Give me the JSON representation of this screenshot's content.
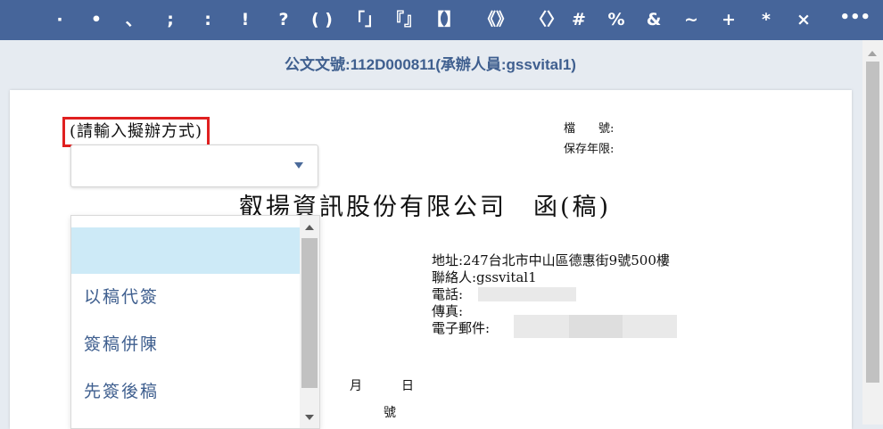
{
  "toolbar": {
    "symbols": [
      "·",
      "•",
      "、",
      ";",
      ":",
      "!",
      "?",
      "( )",
      "「」",
      "『』",
      "【】",
      "《》",
      "〈〉",
      "#",
      "%",
      "&",
      "~",
      "+",
      "*",
      "×"
    ],
    "more": "•••"
  },
  "header": {
    "doc_number": "公文文號:112D000811(承辦人員:gssvital1)"
  },
  "form": {
    "method_label": "(請輸入擬辦方式)",
    "select_value": ""
  },
  "meta": {
    "file_no_label": "檔　　號:",
    "retention_label": "保存年限:"
  },
  "document": {
    "org_title": "叡揚資訊股份有限公司　函(稿)",
    "address": "地址:247台北市中山區德惠街9號500樓",
    "contact": "聯絡人:gssvital1",
    "phone_label": "電話:",
    "fax_label": "傳真:",
    "email_label": "電子郵件:",
    "date_month": "月",
    "date_day": "日",
    "number_label": "號"
  },
  "dropdown": {
    "options": [
      "",
      "以稿代簽",
      "簽稿併陳",
      "先簽後稿"
    ],
    "selected_index": 0
  },
  "colors": {
    "toolbar_bg": "#46659a",
    "accent_text": "#3f5f8f",
    "highlight_border": "#e02020",
    "selected_option_bg": "#cdeaf7"
  }
}
